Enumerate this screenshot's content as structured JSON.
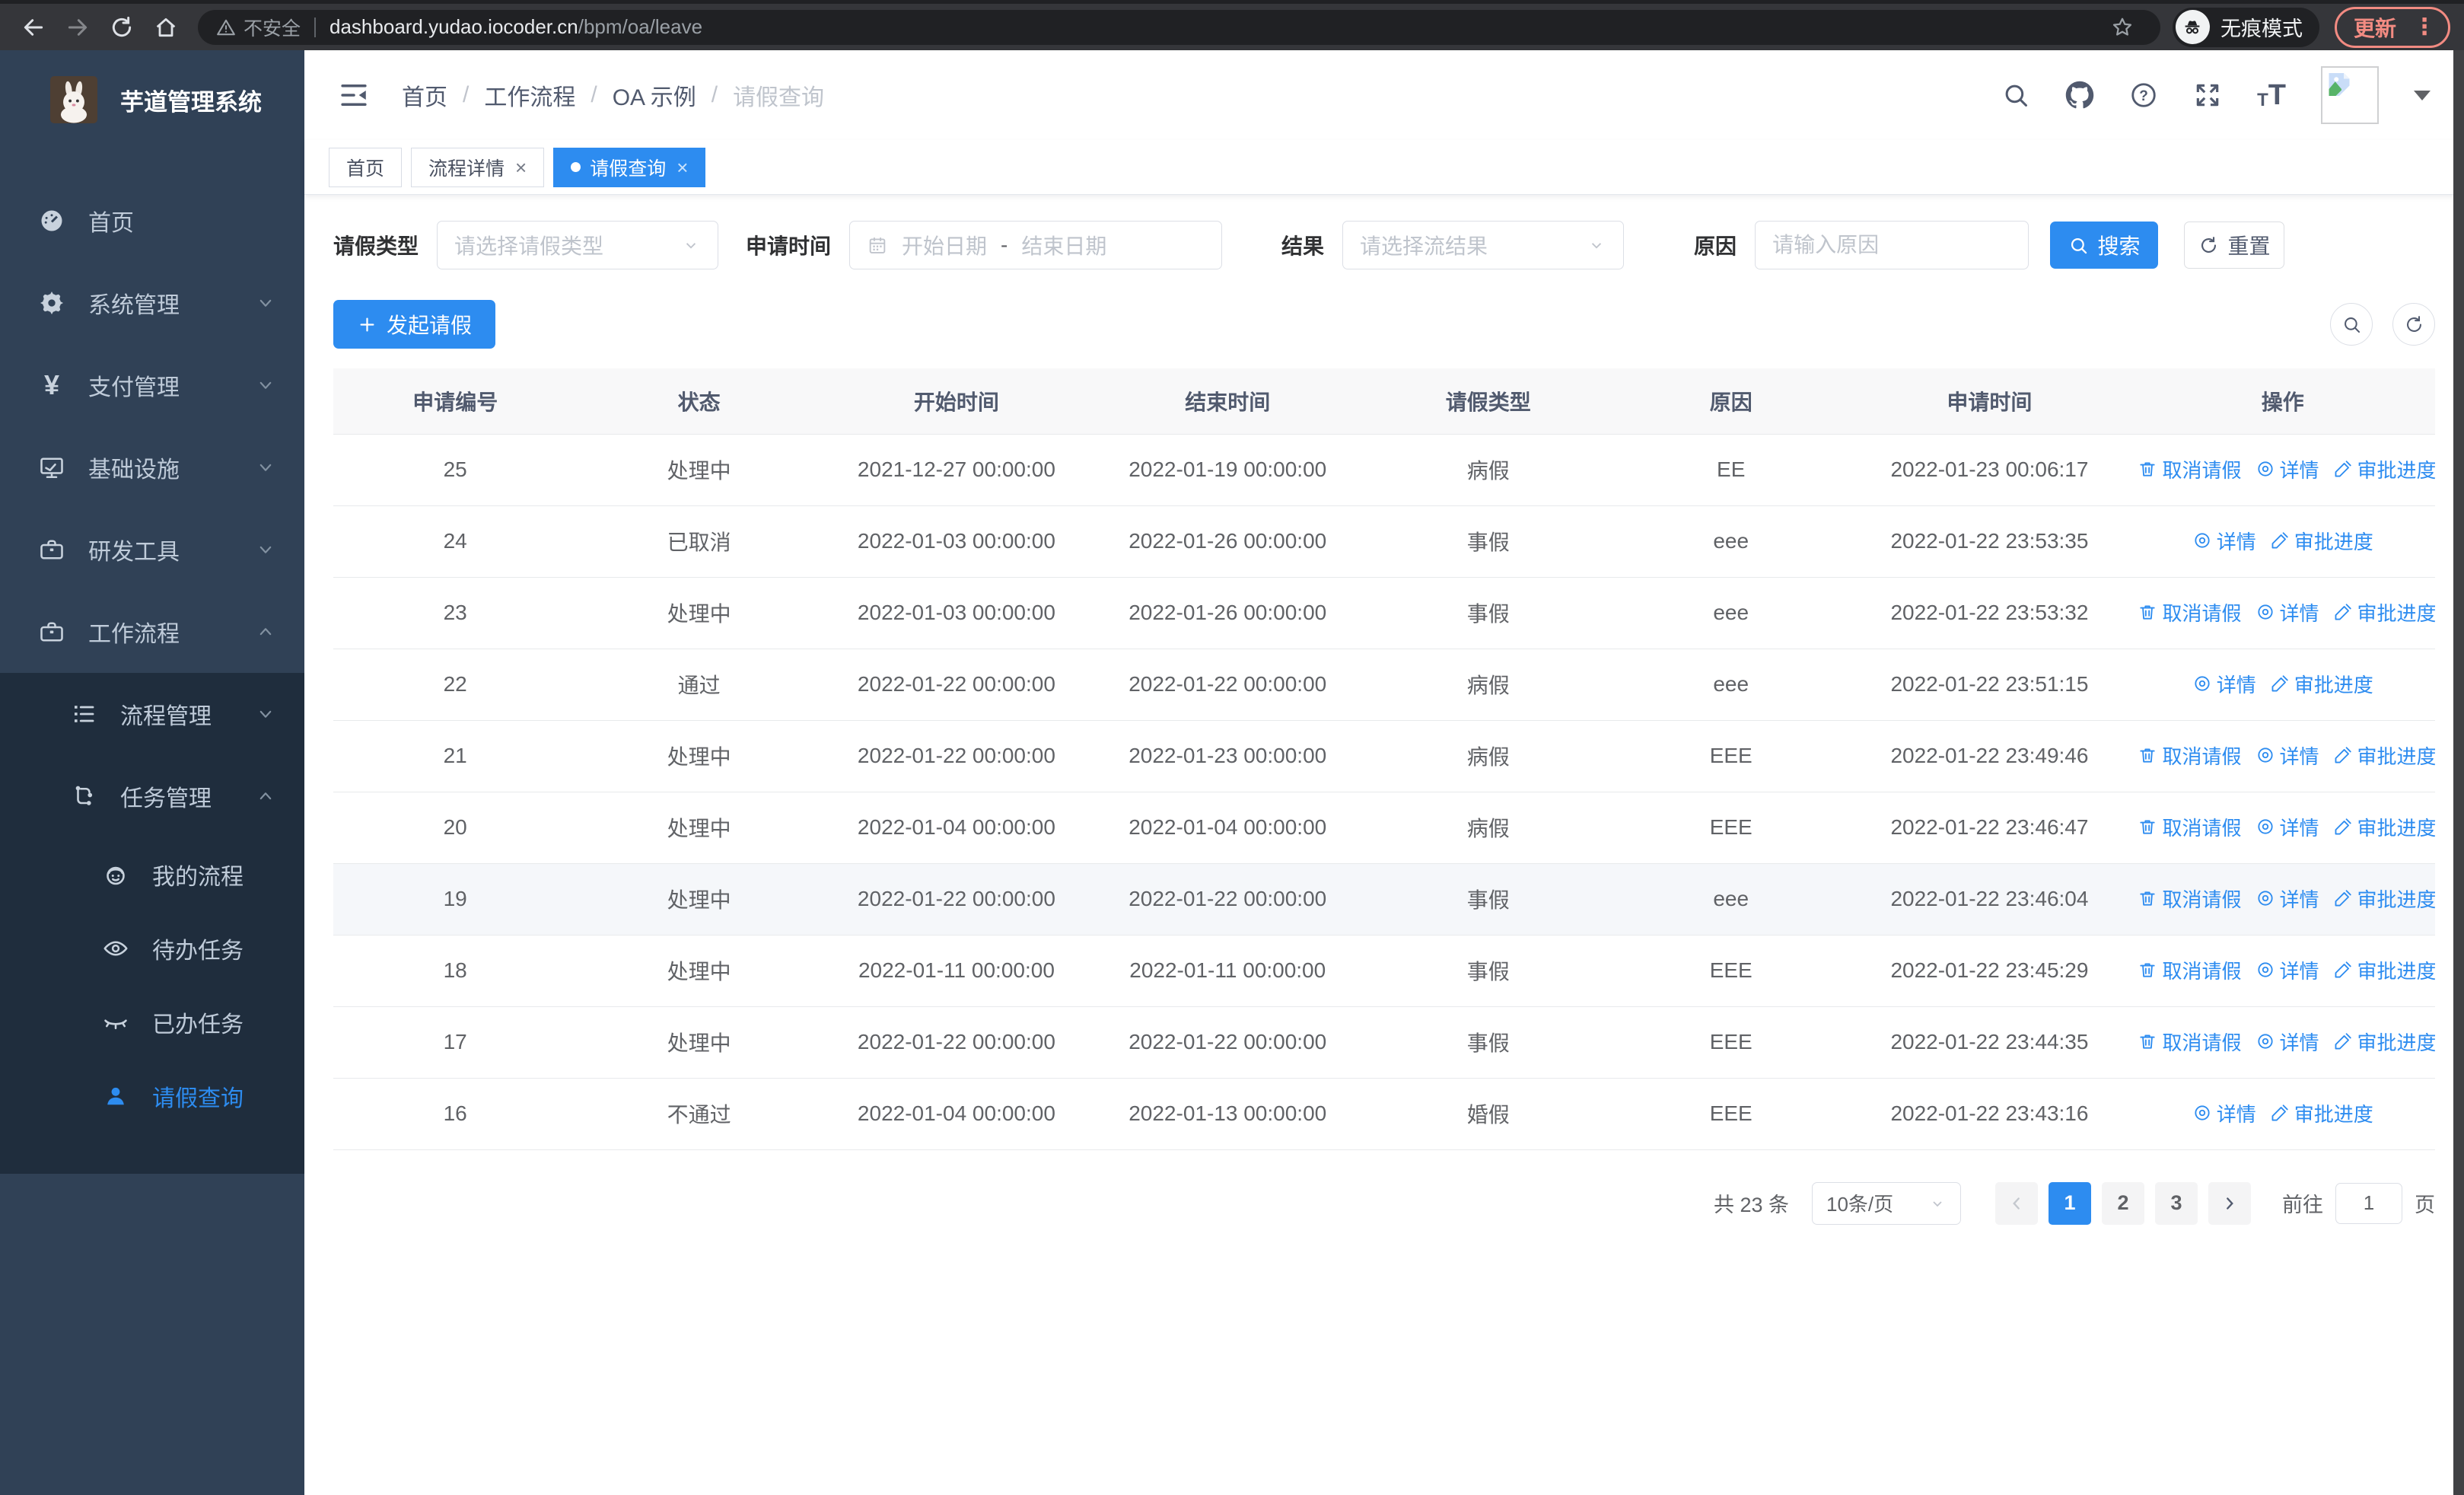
{
  "browser": {
    "security_label": "不安全",
    "url_host": "dashboard.yudao.iocoder.cn",
    "url_path": "/bpm/oa/leave",
    "incognito_label": "无痕模式",
    "update_label": "更新"
  },
  "sidebar": {
    "app_title": "芋道管理系统",
    "items": [
      {
        "label": "首页",
        "icon": "dashboard-icon",
        "level": 0,
        "state": "none",
        "active": false
      },
      {
        "label": "系统管理",
        "icon": "gear-icon",
        "level": 0,
        "state": "collapsed",
        "active": false
      },
      {
        "label": "支付管理",
        "icon": "yen-icon",
        "level": 0,
        "state": "collapsed",
        "active": false
      },
      {
        "label": "基础设施",
        "icon": "monitor-icon",
        "level": 0,
        "state": "collapsed",
        "active": false
      },
      {
        "label": "研发工具",
        "icon": "toolbox-icon",
        "level": 0,
        "state": "collapsed",
        "active": false
      },
      {
        "label": "工作流程",
        "icon": "briefcase-icon",
        "level": 0,
        "state": "expanded",
        "active": false
      }
    ],
    "submenu_items": [
      {
        "label": "流程管理",
        "icon": "flow-list-icon",
        "level": 1,
        "state": "collapsed",
        "active": false
      },
      {
        "label": "任务管理",
        "icon": "task-tree-icon",
        "level": 1,
        "state": "expanded",
        "active": false
      },
      {
        "label": "我的流程",
        "icon": "face-icon",
        "level": 2,
        "state": "none",
        "active": false
      },
      {
        "label": "待办任务",
        "icon": "eye-icon",
        "level": 2,
        "state": "none",
        "active": false
      },
      {
        "label": "已办任务",
        "icon": "eye-closed-icon",
        "level": 2,
        "state": "none",
        "active": false
      },
      {
        "label": "请假查询",
        "icon": "user-icon",
        "level": 2,
        "state": "none",
        "active": true
      }
    ]
  },
  "header": {
    "breadcrumb": [
      "首页",
      "工作流程",
      "OA 示例",
      "请假查询"
    ]
  },
  "tabs": [
    {
      "label": "首页",
      "closable": false,
      "active": false
    },
    {
      "label": "流程详情",
      "closable": true,
      "active": false
    },
    {
      "label": "请假查询",
      "closable": true,
      "active": true
    }
  ],
  "filters": {
    "leave_type_label": "请假类型",
    "leave_type_placeholder": "请选择请假类型",
    "apply_time_label": "申请时间",
    "start_date_placeholder": "开始日期",
    "date_separator": "-",
    "end_date_placeholder": "结束日期",
    "result_label": "结果",
    "result_placeholder": "请选择流结果",
    "reason_label": "原因",
    "reason_placeholder": "请输入原因",
    "search_label": "搜索",
    "reset_label": "重置"
  },
  "toolbar": {
    "create_label": "发起请假"
  },
  "table": {
    "columns": [
      "申请编号",
      "状态",
      "开始时间",
      "结束时间",
      "请假类型",
      "原因",
      "申请时间",
      "操作"
    ],
    "action_labels": {
      "cancel": "取消请假",
      "detail": "详情",
      "progress": "审批进度"
    },
    "rows": [
      {
        "id": "25",
        "status": "处理中",
        "start": "2021-12-27 00:00:00",
        "end": "2022-01-19 00:00:00",
        "type": "病假",
        "reason": "EE",
        "applied": "2022-01-23 00:06:17",
        "actions": [
          "cancel",
          "detail",
          "progress"
        ],
        "highlight": false
      },
      {
        "id": "24",
        "status": "已取消",
        "start": "2022-01-03 00:00:00",
        "end": "2022-01-26 00:00:00",
        "type": "事假",
        "reason": "eee",
        "applied": "2022-01-22 23:53:35",
        "actions": [
          "detail",
          "progress"
        ],
        "highlight": false
      },
      {
        "id": "23",
        "status": "处理中",
        "start": "2022-01-03 00:00:00",
        "end": "2022-01-26 00:00:00",
        "type": "事假",
        "reason": "eee",
        "applied": "2022-01-22 23:53:32",
        "actions": [
          "cancel",
          "detail",
          "progress"
        ],
        "highlight": false
      },
      {
        "id": "22",
        "status": "通过",
        "start": "2022-01-22 00:00:00",
        "end": "2022-01-22 00:00:00",
        "type": "病假",
        "reason": "eee",
        "applied": "2022-01-22 23:51:15",
        "actions": [
          "detail",
          "progress"
        ],
        "highlight": false
      },
      {
        "id": "21",
        "status": "处理中",
        "start": "2022-01-22 00:00:00",
        "end": "2022-01-23 00:00:00",
        "type": "病假",
        "reason": "EEE",
        "applied": "2022-01-22 23:49:46",
        "actions": [
          "cancel",
          "detail",
          "progress"
        ],
        "highlight": false
      },
      {
        "id": "20",
        "status": "处理中",
        "start": "2022-01-04 00:00:00",
        "end": "2022-01-04 00:00:00",
        "type": "病假",
        "reason": "EEE",
        "applied": "2022-01-22 23:46:47",
        "actions": [
          "cancel",
          "detail",
          "progress"
        ],
        "highlight": false
      },
      {
        "id": "19",
        "status": "处理中",
        "start": "2022-01-22 00:00:00",
        "end": "2022-01-22 00:00:00",
        "type": "事假",
        "reason": "eee",
        "applied": "2022-01-22 23:46:04",
        "actions": [
          "cancel",
          "detail",
          "progress"
        ],
        "highlight": true
      },
      {
        "id": "18",
        "status": "处理中",
        "start": "2022-01-11 00:00:00",
        "end": "2022-01-11 00:00:00",
        "type": "事假",
        "reason": "EEE",
        "applied": "2022-01-22 23:45:29",
        "actions": [
          "cancel",
          "detail",
          "progress"
        ],
        "highlight": false
      },
      {
        "id": "17",
        "status": "处理中",
        "start": "2022-01-22 00:00:00",
        "end": "2022-01-22 00:00:00",
        "type": "事假",
        "reason": "EEE",
        "applied": "2022-01-22 23:44:35",
        "actions": [
          "cancel",
          "detail",
          "progress"
        ],
        "highlight": false
      },
      {
        "id": "16",
        "status": "不通过",
        "start": "2022-01-04 00:00:00",
        "end": "2022-01-13 00:00:00",
        "type": "婚假",
        "reason": "EEE",
        "applied": "2022-01-22 23:43:16",
        "actions": [
          "detail",
          "progress"
        ],
        "highlight": false
      }
    ]
  },
  "pagination": {
    "total_text": "共 23 条",
    "page_size": "10条/页",
    "pages": [
      "1",
      "2",
      "3"
    ],
    "active_page": "1",
    "goto_label": "前往",
    "goto_value": "1",
    "page_suffix": "页"
  },
  "colors": {
    "accent": "#2d8cf0",
    "sidebar_bg": "#304156",
    "submenu_bg": "#1f2d3d",
    "table_header_bg": "#f8f8f9",
    "row_highlight": "#f5f7fa",
    "update_button": "#f28b82"
  }
}
